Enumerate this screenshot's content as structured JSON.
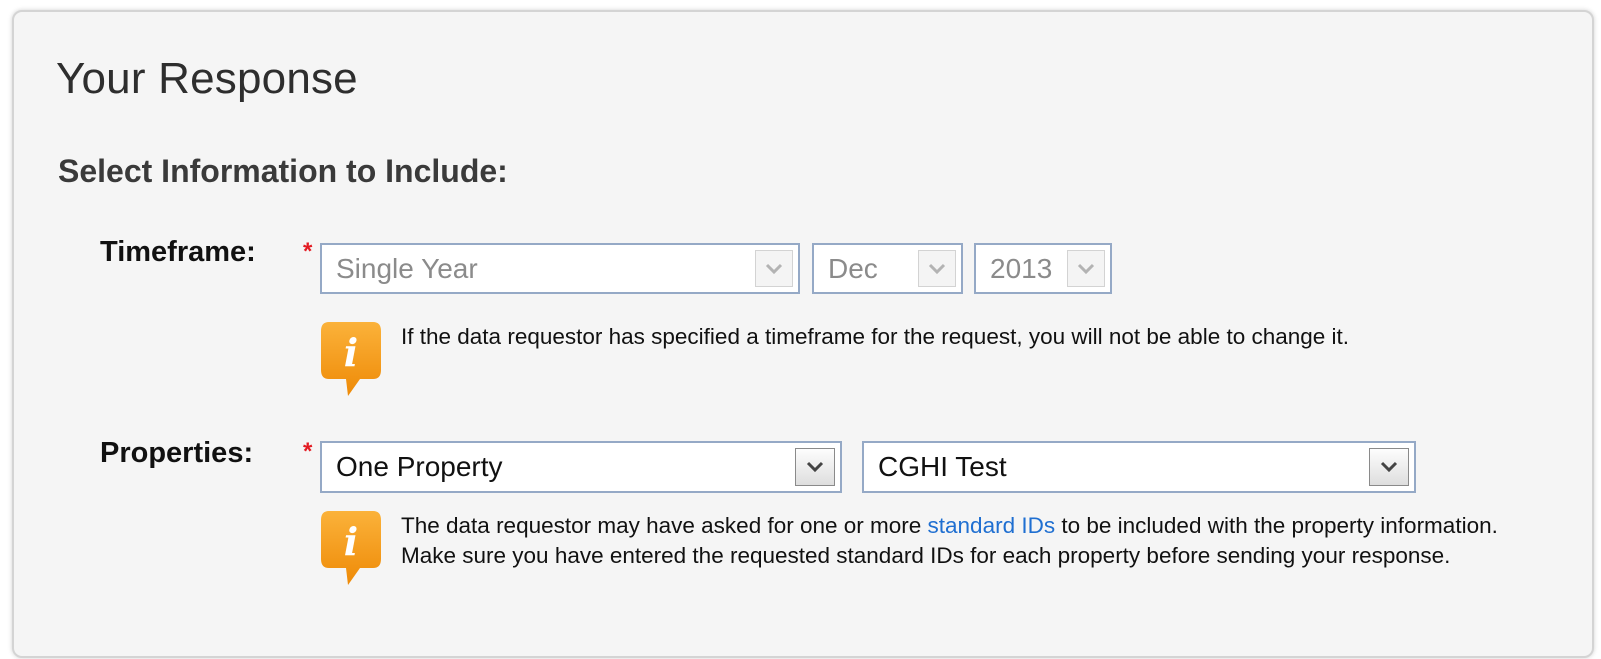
{
  "section": {
    "title": "Your Response",
    "subtitle": "Select Information to Include:"
  },
  "timeframe": {
    "label": "Timeframe:",
    "required_mark": "*",
    "period_value": "Single Year",
    "month_value": "Dec",
    "year_value": "2013",
    "disabled": true,
    "info_text": "If the data requestor has specified a timeframe for the request, you will not be able to change it."
  },
  "properties": {
    "label": "Properties:",
    "required_mark": "*",
    "scope_value": "One Property",
    "property_value": "CGHI Test",
    "info_text_before": "The data requestor may have asked for one or more ",
    "info_link": "standard IDs",
    "info_text_after": " to be included with the property information. Make sure you have entered the requested standard IDs for each property before sending your response."
  },
  "icons": {
    "info": "info-speech-bubble-icon",
    "dropdown": "chevron-down-icon"
  },
  "colors": {
    "required": "#e31b23",
    "info_icon": "#f39a12",
    "link": "#1f6fd1",
    "panel_bg": "#f5f5f5"
  }
}
